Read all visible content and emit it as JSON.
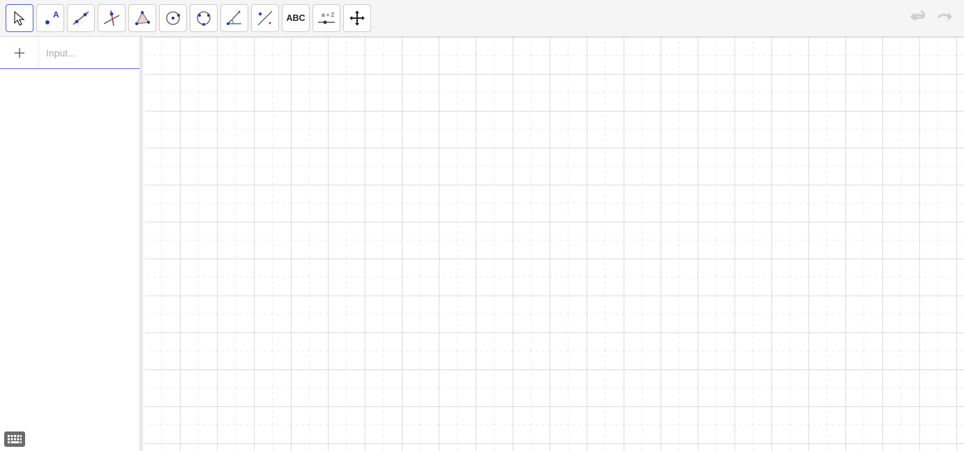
{
  "toolbar": {
    "tools": [
      {
        "name": "move"
      },
      {
        "name": "point"
      },
      {
        "name": "line"
      },
      {
        "name": "perpendicular"
      },
      {
        "name": "polygon"
      },
      {
        "name": "circle"
      },
      {
        "name": "ellipse"
      },
      {
        "name": "angle"
      },
      {
        "name": "reflect"
      },
      {
        "name": "text",
        "label": "ABC"
      },
      {
        "name": "slider",
        "label": "a = 2"
      },
      {
        "name": "pan"
      }
    ]
  },
  "algebra": {
    "input_placeholder": "Input..."
  }
}
